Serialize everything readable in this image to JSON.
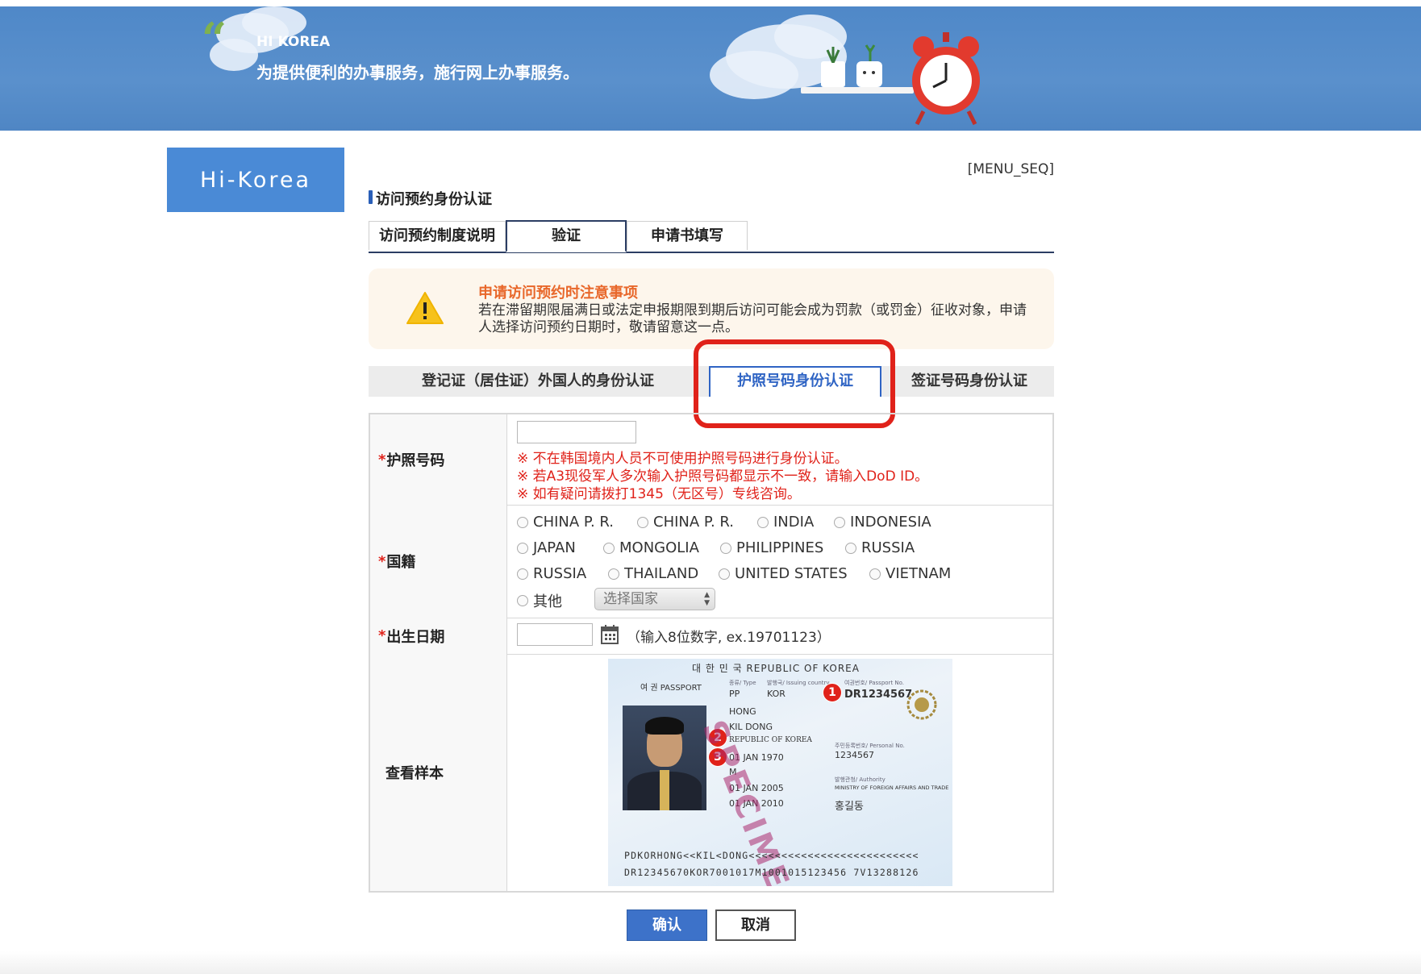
{
  "banner": {
    "brand": "HI KOREA",
    "tagline": "为提供便利的办事服务，施行网上办事服务。"
  },
  "logo": {
    "text": "Hi-Korea"
  },
  "menu_seq": "[MENU_SEQ]",
  "page_title": "访问预约身份认证",
  "top_tabs": [
    {
      "label": "访问预约制度说明",
      "active": false
    },
    {
      "label": "验证",
      "active": true
    },
    {
      "label": "申请书填写",
      "active": false
    }
  ],
  "notice": {
    "title": "申请访问预约时注意事项",
    "body": "若在滞留期限届满日或法定申报期限到期后访问可能会成为罚款（或罚金）征收对象，申请人选择访问预约日期时，敬请留意这一点。"
  },
  "verify_tabs": [
    {
      "label": "登记证（居住证）外国人的身份认证",
      "active": false
    },
    {
      "label": "护照号码身份认证",
      "active": true
    },
    {
      "label": "签证号码身份认证",
      "active": false
    }
  ],
  "form": {
    "passport": {
      "label": "护照号码",
      "value": "",
      "warnings": [
        "※ 不在韩国境内人员不可使用护照号码进行身份认证。",
        "※ 若A3现役军人多次输入护照号码都显示不一致，请输入DoD ID。",
        "※ 如有疑问请拨打1345（无区号）专线咨询。"
      ]
    },
    "nationality": {
      "label": "国籍",
      "options": [
        "CHINA P. R.",
        "CHINA P. R.",
        "INDIA",
        "INDONESIA",
        "JAPAN",
        "MONGOLIA",
        "PHILIPPINES",
        "RUSSIA",
        "RUSSIA",
        "THAILAND",
        "UNITED STATES",
        "VIETNAM"
      ],
      "other_label": "其他",
      "select_placeholder": "选择国家"
    },
    "birth": {
      "label": "出生日期",
      "value": "",
      "hint": "（输入8位数字, ex.19701123）"
    },
    "sample": {
      "label": "查看样本",
      "passport": {
        "header": "대 한 민 국   REPUBLIC OF KOREA",
        "passport_label": "여 권  PASSPORT",
        "type_small": "종류/ Type",
        "country_small": "발행국/ Issuing country",
        "passport_no_small": "여권번호/ Passport No.",
        "type": "PP",
        "country": "KOR",
        "passport_no": "DR1234567",
        "surname": "HONG",
        "given_name": "KIL DONG",
        "nationality": "REPUBLIC OF KOREA",
        "dob": "01 JAN 1970",
        "sex": "M",
        "issue_date": "01 JAN 2005",
        "expiry_date": "01 JAN 2010",
        "personal_no_small": "주민등록번호/ Personal No.",
        "personal_no": "1234567",
        "authority_small": "발행관청/ Authority",
        "authority": "MINISTRY OF FOREIGN AFFAIRS AND TRADE",
        "korean_name": "홍길동",
        "watermark": "SPECIMEN",
        "mrz_line1": "PDKORHONG<<KIL<DONG<<<<<<<<<<<<<<<<<<<<<<<<<<",
        "mrz_line2": "DR12345670KOR7001017M1001015123456 7V13288126",
        "markers": [
          "1",
          "2",
          "3"
        ]
      }
    }
  },
  "buttons": {
    "confirm": "确认",
    "cancel": "取消"
  },
  "colors": {
    "banner": "#4f88c8",
    "logo": "#4a8ad6",
    "accent_blue": "#2f64c4",
    "highlight_red": "#e0221a",
    "notice_title": "#e8672a",
    "confirm_button": "#3d72c9"
  },
  "icons": {
    "warning": "warning-triangle-icon",
    "calendar": "calendar-icon",
    "select_arrow": "up-down-arrow-icon"
  }
}
